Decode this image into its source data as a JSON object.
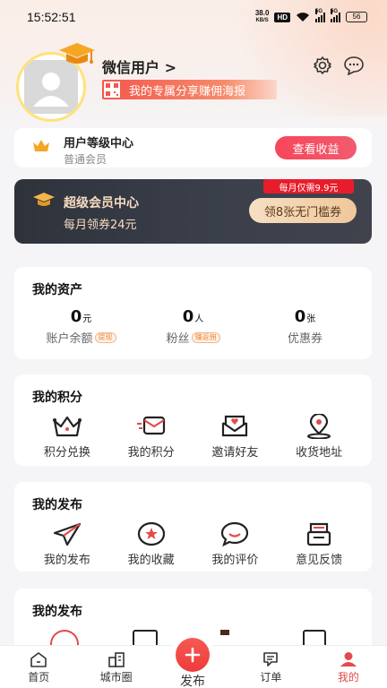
{
  "status_bar": {
    "time": "15:52:51",
    "net_speed_value": "38.0",
    "net_speed_unit": "KB/S",
    "hd": "HD",
    "signal_1_gen": "5G",
    "signal_2_gen": "5G",
    "battery": "56"
  },
  "profile": {
    "username": "微信用户 >",
    "share_text": "我的专属分享赚佣海报"
  },
  "level_card": {
    "title": "用户等级中心",
    "subtitle": "普通会员",
    "button": "查看收益"
  },
  "vip_card": {
    "title": "超级会员中心",
    "subtitle": "每月领券24元",
    "price_tag": "每月仅需9.9元",
    "button": "领8张无门槛券"
  },
  "assets": {
    "title": "我的资产",
    "items": [
      {
        "value": "0",
        "unit": "元",
        "label": "账户余额",
        "tag": "提现"
      },
      {
        "value": "0",
        "unit": "人",
        "label": "粉丝",
        "tag": "赚返佣"
      },
      {
        "value": "0",
        "unit": "张",
        "label": "优惠券",
        "tag": ""
      }
    ]
  },
  "points": {
    "title": "我的积分",
    "items": [
      {
        "label": "积分兑换",
        "icon": "crown-icon"
      },
      {
        "label": "我的积分",
        "icon": "mail-fast-icon"
      },
      {
        "label": "邀请好友",
        "icon": "envelope-heart-icon"
      },
      {
        "label": "收货地址",
        "icon": "location-pin-icon"
      }
    ]
  },
  "publish": {
    "title": "我的发布",
    "items": [
      {
        "label": "我的发布",
        "icon": "paper-plane-icon"
      },
      {
        "label": "我的收藏",
        "icon": "star-icon"
      },
      {
        "label": "我的评价",
        "icon": "chat-bubble-icon"
      },
      {
        "label": "意见反馈",
        "icon": "feedback-icon"
      }
    ]
  },
  "publish2": {
    "title": "我的发布"
  },
  "bottom_nav": {
    "items": [
      {
        "label": "首页",
        "icon": "home-icon"
      },
      {
        "label": "城市圈",
        "icon": "city-icon"
      },
      {
        "label": "发布",
        "icon": "plus-icon"
      },
      {
        "label": "订单",
        "icon": "order-icon"
      },
      {
        "label": "我的",
        "icon": "person-icon"
      }
    ],
    "active": "我的"
  },
  "colors": {
    "accent_red": "#ee3b3b",
    "vip_gold": "#f6dcc0",
    "vip_bg": "#2e323b"
  }
}
